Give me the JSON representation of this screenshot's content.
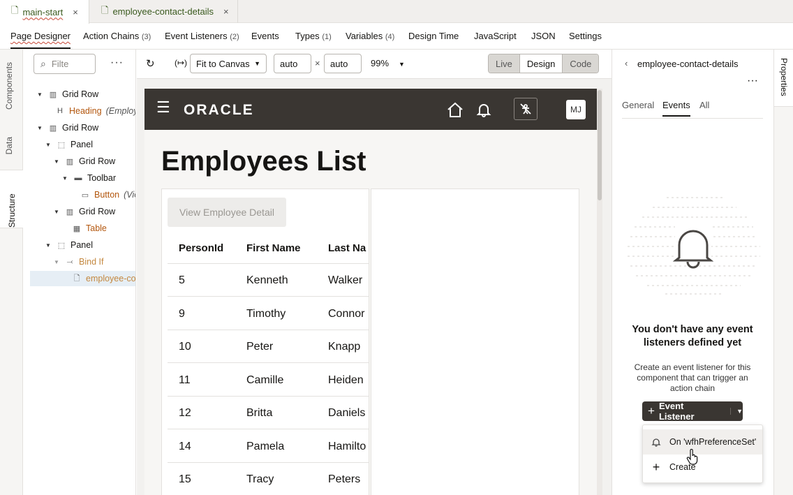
{
  "file_tabs": [
    {
      "label": "main-start",
      "close": "×"
    },
    {
      "label": "employee-contact-details",
      "close": "×"
    }
  ],
  "designer_tabs": [
    {
      "label": "Page Designer",
      "count": ""
    },
    {
      "label": "Action Chains",
      "count": "(3)"
    },
    {
      "label": "Event Listeners",
      "count": "(2)"
    },
    {
      "label": "Events",
      "count": ""
    },
    {
      "label": "Types",
      "count": "(1)"
    },
    {
      "label": "Variables",
      "count": "(4)"
    },
    {
      "label": "Design Time",
      "count": ""
    },
    {
      "label": "JavaScript",
      "count": ""
    },
    {
      "label": "JSON",
      "count": ""
    },
    {
      "label": "Settings",
      "count": ""
    }
  ],
  "left_rail": [
    "Components",
    "Data",
    "Structure"
  ],
  "structure": {
    "filter_placeholder": "Filte",
    "more": "···",
    "nodes": [
      {
        "label": "Grid Row",
        "extra": ""
      },
      {
        "label": "Heading",
        "extra": "(Employ"
      },
      {
        "label": "Grid Row",
        "extra": ""
      },
      {
        "label": "Panel",
        "extra": ""
      },
      {
        "label": "Grid Row",
        "extra": ""
      },
      {
        "label": "Toolbar",
        "extra": ""
      },
      {
        "label": "Button",
        "extra": "(Vie"
      },
      {
        "label": "Grid Row",
        "extra": ""
      },
      {
        "label": "Table",
        "extra": ""
      },
      {
        "label": "Panel",
        "extra": ""
      },
      {
        "label": "Bind If",
        "extra": ""
      },
      {
        "label": "employee-co",
        "extra": ""
      }
    ]
  },
  "canvas_toolbar": {
    "fit": "Fit to Canvas",
    "width": "auto",
    "times": "×",
    "height": "auto",
    "zoom": "99%",
    "modes": [
      "Live",
      "Design",
      "Code"
    ]
  },
  "app": {
    "brand": "ORACLE",
    "avatar": "MJ",
    "title": "Employees List",
    "view_button": "View Employee Detail",
    "columns": [
      "PersonId",
      "First Name",
      "Last Na"
    ],
    "rows": [
      [
        "5",
        "Kenneth",
        "Walker"
      ],
      [
        "9",
        "Timothy",
        "Connor"
      ],
      [
        "10",
        "Peter",
        "Knapp"
      ],
      [
        "11",
        "Camille",
        "Heiden"
      ],
      [
        "12",
        "Britta",
        "Daniels"
      ],
      [
        "14",
        "Pamela",
        "Hamilto"
      ],
      [
        "15",
        "Tracy",
        "Peters"
      ]
    ]
  },
  "properties": {
    "breadcrumb": "employee-contact-details",
    "more": "···",
    "tabs": [
      "General",
      "Events",
      "All"
    ],
    "empty_title": "You don't have any event listeners defined yet",
    "empty_desc": "Create an event listener for this component that can trigger an action chain",
    "add_button": "Event Listener",
    "menu": [
      "On 'wfhPreferenceSet'",
      "Create"
    ],
    "rail_label": "Properties"
  },
  "colors": {
    "accent": "#c74634",
    "header": "#3a3632",
    "button": "#3a3632"
  }
}
